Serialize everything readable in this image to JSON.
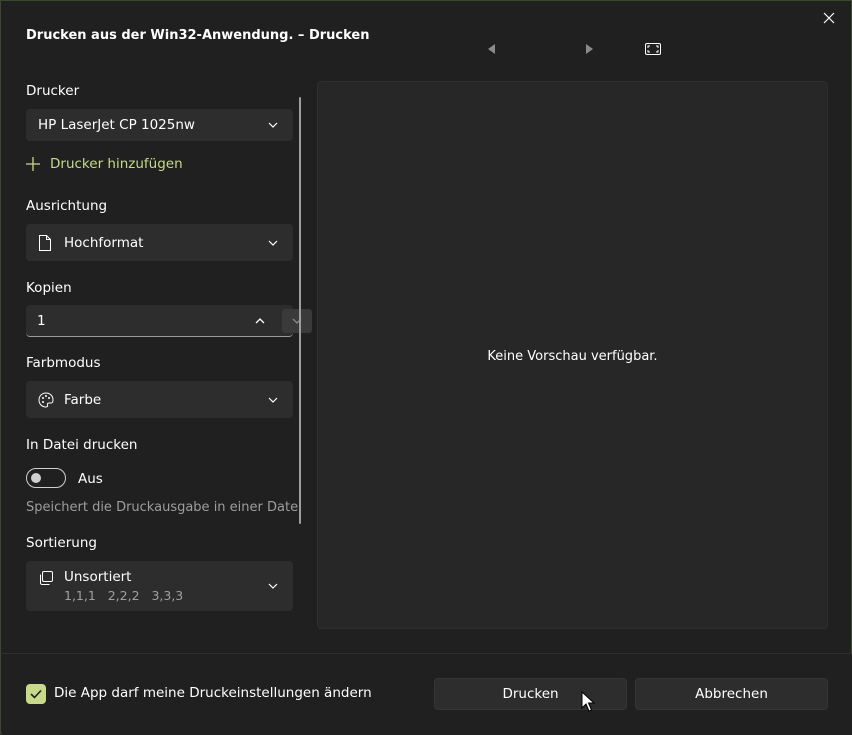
{
  "window": {
    "title": "Drucken aus der Win32-Anwendung. – Drucken"
  },
  "printer": {
    "label": "Drucker",
    "value": "HP LaserJet CP 1025nw",
    "add_label": "Drucker hinzufügen"
  },
  "orientation": {
    "label": "Ausrichtung",
    "value": "Hochformat"
  },
  "copies": {
    "label": "Kopien",
    "value": "1"
  },
  "color_mode": {
    "label": "Farbmodus",
    "value": "Farbe"
  },
  "print_to_file": {
    "label": "In Datei drucken",
    "state_label": "Aus",
    "hint": "Speichert die Druckausgabe in einer Datei",
    "on": false
  },
  "collation": {
    "label": "Sortierung",
    "value": "Unsortiert",
    "detail": "1,1,1   2,2,2   3,3,3"
  },
  "preview": {
    "message": "Keine Vorschau verfügbar."
  },
  "footer": {
    "checkbox_label": "Die App darf meine Druckeinstellungen ändern",
    "checked": true,
    "print_button": "Drucken",
    "cancel_button": "Abbrechen"
  },
  "colors": {
    "accent": "#c9d98a",
    "background": "#202020",
    "control": "#2d2d2d"
  }
}
